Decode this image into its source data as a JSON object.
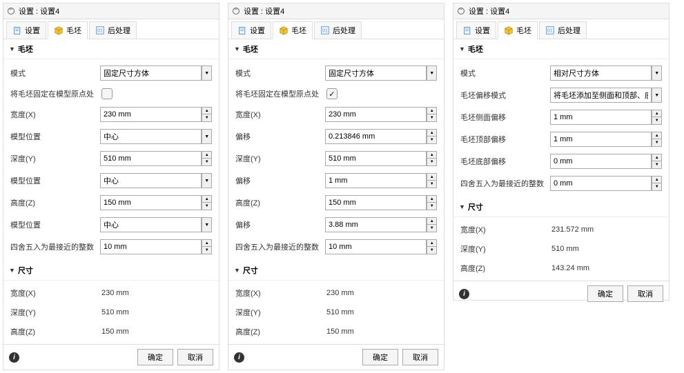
{
  "header_title": "设置 : 设置4",
  "tabs": {
    "settings": "设置",
    "stock": "毛坯",
    "post": "后处理"
  },
  "sections": {
    "stock": "毛坯",
    "dim": "尺寸"
  },
  "buttons": {
    "ok": "确定",
    "cancel": "取消"
  },
  "panel1": {
    "mode_label": "模式",
    "mode_value": "固定尺寸方体",
    "fix_origin_label": "将毛坯固定在模型原点处",
    "fix_origin_checked": false,
    "width_label": "宽度(X)",
    "width_value": "230 mm",
    "model_pos_label": "模型位置",
    "model_pos_value": "中心",
    "depth_label": "深度(Y)",
    "depth_value": "510 mm",
    "model_pos_label2": "模型位置",
    "model_pos_value2": "中心",
    "height_label": "高度(Z)",
    "height_value": "150 mm",
    "model_pos_label3": "模型位置",
    "model_pos_value3": "中心",
    "round_label": "四舍五入为最接近的整数",
    "round_value": "10 mm",
    "dim_width_label": "宽度(X)",
    "dim_width_value": "230 mm",
    "dim_depth_label": "深度(Y)",
    "dim_depth_value": "510 mm",
    "dim_height_label": "高度(Z)",
    "dim_height_value": "150 mm"
  },
  "panel2": {
    "mode_label": "模式",
    "mode_value": "固定尺寸方体",
    "fix_origin_label": "将毛坯固定在模型原点处",
    "fix_origin_checked": true,
    "width_label": "宽度(X)",
    "width_value": "230 mm",
    "offset_label": "偏移",
    "offset_x_value": "0.213846 mm",
    "depth_label": "深度(Y)",
    "depth_value": "510 mm",
    "offset_y_value": "1 mm",
    "height_label": "高度(Z)",
    "height_value": "150 mm",
    "offset_z_value": "3.88 mm",
    "round_label": "四舍五入为最接近的整数",
    "round_value": "10 mm",
    "dim_width_label": "宽度(X)",
    "dim_width_value": "230 mm",
    "dim_depth_label": "深度(Y)",
    "dim_depth_value": "510 mm",
    "dim_height_label": "高度(Z)",
    "dim_height_value": "150 mm"
  },
  "panel3": {
    "mode_label": "模式",
    "mode_value": "相对尺寸方体",
    "offset_mode_label": "毛坯偏移模式",
    "offset_mode_value": "将毛坯添加至侧面和顶部、底部",
    "side_offset_label": "毛坯侧面偏移",
    "side_offset_value": "1 mm",
    "top_offset_label": "毛坯顶部偏移",
    "top_offset_value": "1 mm",
    "bottom_offset_label": "毛坯底部偏移",
    "bottom_offset_value": "0 mm",
    "round_label": "四舍五入为最接近的整数",
    "round_value": "0 mm",
    "dim_width_label": "宽度(X)",
    "dim_width_value": "231.572 mm",
    "dim_depth_label": "深度(Y)",
    "dim_depth_value": "510 mm",
    "dim_height_label": "高度(Z)",
    "dim_height_value": "143.24 mm"
  }
}
